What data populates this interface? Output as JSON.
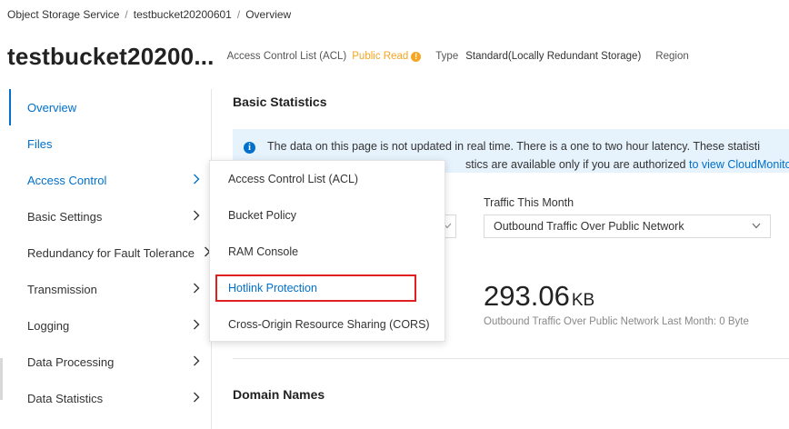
{
  "breadcrumb": {
    "items": [
      "Object Storage Service",
      "testbucket20200601",
      "Overview"
    ],
    "separator": "/"
  },
  "header": {
    "bucket_title": "testbucket20200...",
    "acl_label": "Access Control List (ACL)",
    "acl_value": "Public Read",
    "acl_warning_glyph": "!",
    "type_label": "Type",
    "type_value": "Standard(Locally Redundant Storage)",
    "region_label": "Region"
  },
  "sidebar": {
    "items": [
      {
        "label": "Overview",
        "state": "active"
      },
      {
        "label": "Files",
        "state": "link"
      },
      {
        "label": "Access Control",
        "has_chevron": true
      },
      {
        "label": "Basic Settings",
        "has_chevron": true
      },
      {
        "label": "Redundancy for Fault Tolerance",
        "has_chevron": true
      },
      {
        "label": "Transmission",
        "has_chevron": true
      },
      {
        "label": "Logging",
        "has_chevron": true
      },
      {
        "label": "Data Processing",
        "has_chevron": true
      },
      {
        "label": "Data Statistics",
        "has_chevron": true
      }
    ]
  },
  "main": {
    "basic_stats_title": "Basic Statistics",
    "notice": {
      "line1": "The data on this page is not updated in real time. There is a one to two hour latency. These statisti",
      "line2_visible": "stics are available only if you are authorized ",
      "link_text": "to view CloudMonito"
    },
    "traffic": {
      "label": "Traffic This Month",
      "select_value": "Outbound Traffic Over Public Network",
      "value": "293.06",
      "unit": "KB",
      "sub_text": "Outbound Traffic Over Public Network Last Month: 0 Byte"
    },
    "domain_names_title": "Domain Names"
  },
  "dropdown": {
    "items": [
      {
        "label": "Access Control List (ACL)"
      },
      {
        "label": "Bucket Policy"
      },
      {
        "label": "RAM Console"
      },
      {
        "label": "Hotlink Protection",
        "highlighted": true
      },
      {
        "label": "Cross-Origin Resource Sharing (CORS)"
      }
    ]
  },
  "colors": {
    "accent": "#0070cc",
    "warning": "#f5a623",
    "highlight_border": "#e02020",
    "notice_bg": "#e6f2fc"
  }
}
